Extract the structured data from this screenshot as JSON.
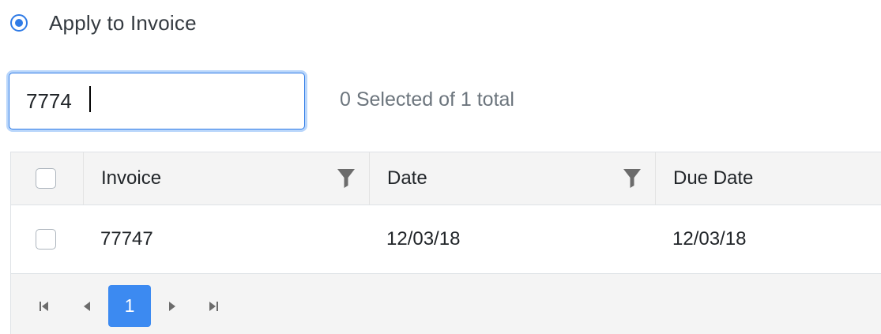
{
  "apply_option": {
    "label": "Apply to Invoice",
    "selected": true
  },
  "search": {
    "value": "7774",
    "placeholder": ""
  },
  "selection_status": "0 Selected of 1 total",
  "grid": {
    "columns": [
      {
        "label": "Invoice",
        "has_filter": true
      },
      {
        "label": "Date",
        "has_filter": true
      },
      {
        "label": "Due Date",
        "has_filter": false
      }
    ],
    "rows": [
      {
        "invoice": "77747",
        "date": "12/03/18",
        "due_date": "12/03/18",
        "checked": false
      }
    ]
  },
  "pager": {
    "current_page": "1",
    "icons": [
      "first-page-icon",
      "previous-page-icon",
      "next-page-icon",
      "last-page-icon"
    ]
  },
  "colors": {
    "accent": "#2f7be6",
    "page_active": "#3c8af1",
    "header_bg": "#f4f4f4",
    "icon_gray": "#6c6c6c"
  }
}
